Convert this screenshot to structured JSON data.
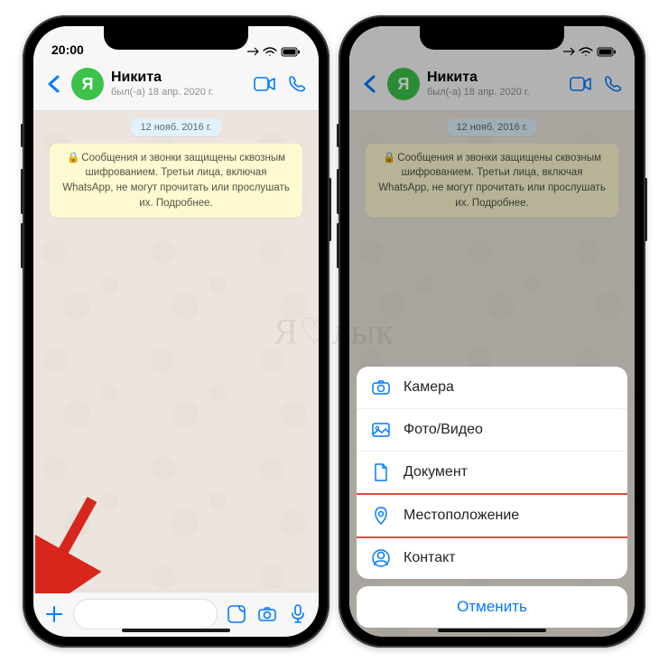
{
  "watermark": "Я♡лык",
  "phone_left": {
    "status": {
      "time": "20:00"
    },
    "header": {
      "avatar_letter": "Я",
      "contact_name": "Никита",
      "last_seen": "был(-а) 18 апр. 2020 г."
    },
    "chat": {
      "date": "12 нояб. 2016 г.",
      "encryption": "Сообщения и звонки защищены сквозным шифрованием. Третьи лица, включая WhatsApp, не могут прочитать или прослушать их. Подробнее."
    }
  },
  "phone_right": {
    "header": {
      "avatar_letter": "Я",
      "contact_name": "Никита",
      "last_seen": "был(-а) 18 апр. 2020 г."
    },
    "chat": {
      "date": "12 нояб. 2016 г.",
      "encryption": "Сообщения и звонки защищены сквозным шифрованием. Третьи лица, включая WhatsApp, не могут прочитать или прослушать их. Подробнее."
    },
    "sheet": {
      "items": [
        {
          "label": "Камера",
          "icon": "camera"
        },
        {
          "label": "Фото/Видео",
          "icon": "photo"
        },
        {
          "label": "Документ",
          "icon": "document"
        },
        {
          "label": "Местоположение",
          "icon": "location",
          "highlighted": true
        },
        {
          "label": "Контакт",
          "icon": "contact"
        }
      ],
      "cancel": "Отменить"
    }
  }
}
